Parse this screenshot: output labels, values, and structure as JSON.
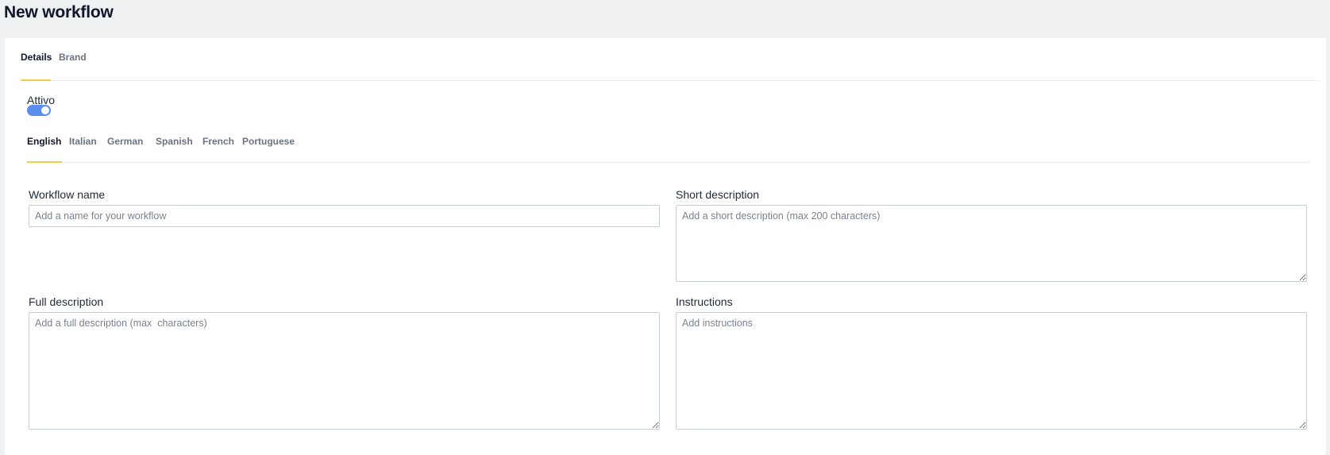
{
  "page": {
    "title": "New workflow"
  },
  "main_tabs": [
    {
      "label": "Details",
      "active": true
    },
    {
      "label": "Brand",
      "active": false
    }
  ],
  "active_toggle": {
    "label": "Attivo",
    "checked": true,
    "color": "#5b8def"
  },
  "language_tabs": [
    {
      "label": "English",
      "active": true
    },
    {
      "label": "Italian",
      "active": false
    },
    {
      "label": "German",
      "active": false
    },
    {
      "label": "Spanish",
      "active": false
    },
    {
      "label": "French",
      "active": false
    },
    {
      "label": "Portuguese",
      "active": false
    }
  ],
  "form": {
    "workflow_name": {
      "label": "Workflow name",
      "value": "",
      "placeholder": "Add a name for your workflow"
    },
    "short_description": {
      "label": "Short description",
      "value": "",
      "placeholder": "Add a short description (max 200 characters)"
    },
    "full_description": {
      "label": "Full description",
      "value": "",
      "placeholder": "Add a full description (max  characters)"
    },
    "instructions": {
      "label": "Instructions",
      "value": "",
      "placeholder": "Add instructions"
    }
  },
  "colors": {
    "accent_underline": "#f2cf4a",
    "toggle_on": "#5b8def",
    "page_background": "#f0f1f3"
  }
}
